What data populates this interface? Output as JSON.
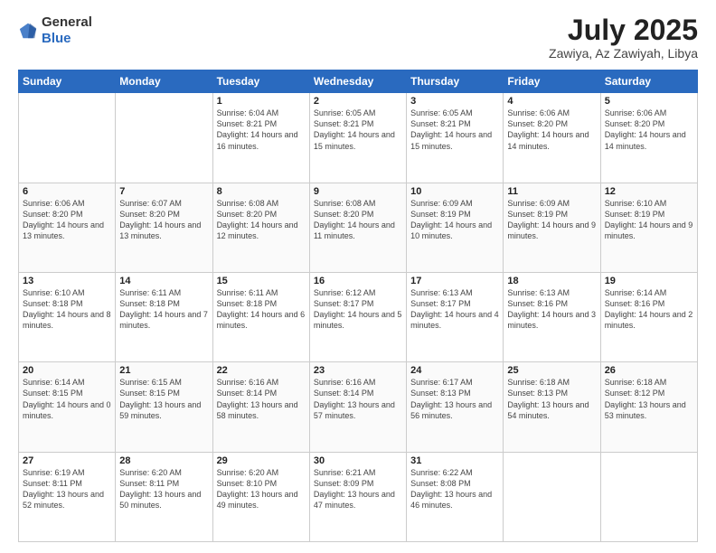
{
  "header": {
    "logo_general": "General",
    "logo_blue": "Blue",
    "title": "July 2025",
    "location": "Zawiya, Az Zawiyah, Libya"
  },
  "days_of_week": [
    "Sunday",
    "Monday",
    "Tuesday",
    "Wednesday",
    "Thursday",
    "Friday",
    "Saturday"
  ],
  "weeks": [
    [
      {
        "day": "",
        "info": ""
      },
      {
        "day": "",
        "info": ""
      },
      {
        "day": "1",
        "info": "Sunrise: 6:04 AM\nSunset: 8:21 PM\nDaylight: 14 hours and 16 minutes."
      },
      {
        "day": "2",
        "info": "Sunrise: 6:05 AM\nSunset: 8:21 PM\nDaylight: 14 hours and 15 minutes."
      },
      {
        "day": "3",
        "info": "Sunrise: 6:05 AM\nSunset: 8:21 PM\nDaylight: 14 hours and 15 minutes."
      },
      {
        "day": "4",
        "info": "Sunrise: 6:06 AM\nSunset: 8:20 PM\nDaylight: 14 hours and 14 minutes."
      },
      {
        "day": "5",
        "info": "Sunrise: 6:06 AM\nSunset: 8:20 PM\nDaylight: 14 hours and 14 minutes."
      }
    ],
    [
      {
        "day": "6",
        "info": "Sunrise: 6:06 AM\nSunset: 8:20 PM\nDaylight: 14 hours and 13 minutes."
      },
      {
        "day": "7",
        "info": "Sunrise: 6:07 AM\nSunset: 8:20 PM\nDaylight: 14 hours and 13 minutes."
      },
      {
        "day": "8",
        "info": "Sunrise: 6:08 AM\nSunset: 8:20 PM\nDaylight: 14 hours and 12 minutes."
      },
      {
        "day": "9",
        "info": "Sunrise: 6:08 AM\nSunset: 8:20 PM\nDaylight: 14 hours and 11 minutes."
      },
      {
        "day": "10",
        "info": "Sunrise: 6:09 AM\nSunset: 8:19 PM\nDaylight: 14 hours and 10 minutes."
      },
      {
        "day": "11",
        "info": "Sunrise: 6:09 AM\nSunset: 8:19 PM\nDaylight: 14 hours and 9 minutes."
      },
      {
        "day": "12",
        "info": "Sunrise: 6:10 AM\nSunset: 8:19 PM\nDaylight: 14 hours and 9 minutes."
      }
    ],
    [
      {
        "day": "13",
        "info": "Sunrise: 6:10 AM\nSunset: 8:18 PM\nDaylight: 14 hours and 8 minutes."
      },
      {
        "day": "14",
        "info": "Sunrise: 6:11 AM\nSunset: 8:18 PM\nDaylight: 14 hours and 7 minutes."
      },
      {
        "day": "15",
        "info": "Sunrise: 6:11 AM\nSunset: 8:18 PM\nDaylight: 14 hours and 6 minutes."
      },
      {
        "day": "16",
        "info": "Sunrise: 6:12 AM\nSunset: 8:17 PM\nDaylight: 14 hours and 5 minutes."
      },
      {
        "day": "17",
        "info": "Sunrise: 6:13 AM\nSunset: 8:17 PM\nDaylight: 14 hours and 4 minutes."
      },
      {
        "day": "18",
        "info": "Sunrise: 6:13 AM\nSunset: 8:16 PM\nDaylight: 14 hours and 3 minutes."
      },
      {
        "day": "19",
        "info": "Sunrise: 6:14 AM\nSunset: 8:16 PM\nDaylight: 14 hours and 2 minutes."
      }
    ],
    [
      {
        "day": "20",
        "info": "Sunrise: 6:14 AM\nSunset: 8:15 PM\nDaylight: 14 hours and 0 minutes."
      },
      {
        "day": "21",
        "info": "Sunrise: 6:15 AM\nSunset: 8:15 PM\nDaylight: 13 hours and 59 minutes."
      },
      {
        "day": "22",
        "info": "Sunrise: 6:16 AM\nSunset: 8:14 PM\nDaylight: 13 hours and 58 minutes."
      },
      {
        "day": "23",
        "info": "Sunrise: 6:16 AM\nSunset: 8:14 PM\nDaylight: 13 hours and 57 minutes."
      },
      {
        "day": "24",
        "info": "Sunrise: 6:17 AM\nSunset: 8:13 PM\nDaylight: 13 hours and 56 minutes."
      },
      {
        "day": "25",
        "info": "Sunrise: 6:18 AM\nSunset: 8:13 PM\nDaylight: 13 hours and 54 minutes."
      },
      {
        "day": "26",
        "info": "Sunrise: 6:18 AM\nSunset: 8:12 PM\nDaylight: 13 hours and 53 minutes."
      }
    ],
    [
      {
        "day": "27",
        "info": "Sunrise: 6:19 AM\nSunset: 8:11 PM\nDaylight: 13 hours and 52 minutes."
      },
      {
        "day": "28",
        "info": "Sunrise: 6:20 AM\nSunset: 8:11 PM\nDaylight: 13 hours and 50 minutes."
      },
      {
        "day": "29",
        "info": "Sunrise: 6:20 AM\nSunset: 8:10 PM\nDaylight: 13 hours and 49 minutes."
      },
      {
        "day": "30",
        "info": "Sunrise: 6:21 AM\nSunset: 8:09 PM\nDaylight: 13 hours and 47 minutes."
      },
      {
        "day": "31",
        "info": "Sunrise: 6:22 AM\nSunset: 8:08 PM\nDaylight: 13 hours and 46 minutes."
      },
      {
        "day": "",
        "info": ""
      },
      {
        "day": "",
        "info": ""
      }
    ]
  ]
}
